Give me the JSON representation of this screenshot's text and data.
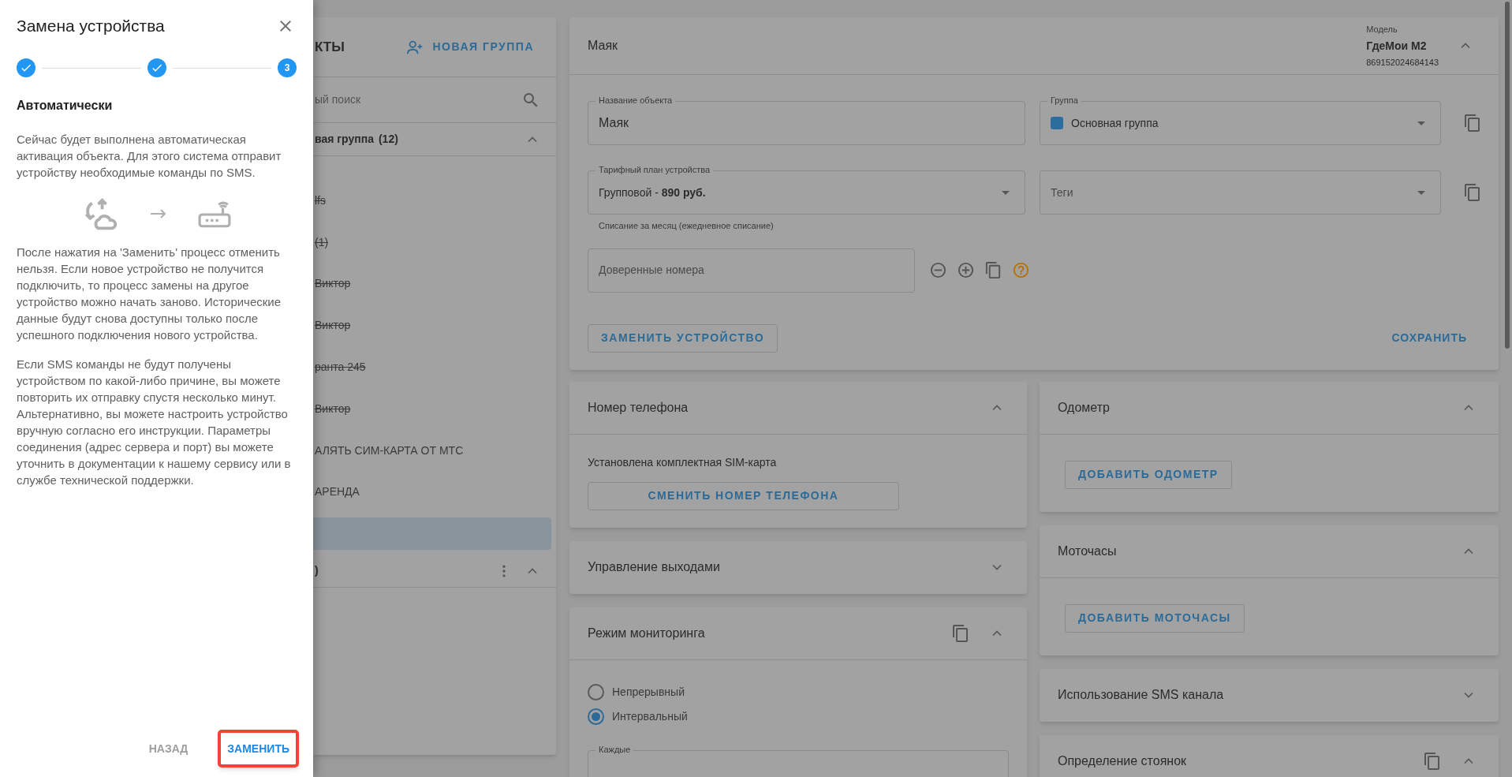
{
  "dialog": {
    "title": "Замена устройства",
    "steps": [
      {
        "completed": true
      },
      {
        "completed": true
      },
      {
        "completed": false,
        "label": "3"
      }
    ],
    "heading": "Автоматически",
    "intro": "Сейчас будет выполнена автоматическая активация объекта. Для этого система отправит устройству необходимые команды по SMS.",
    "notes": [
      "После нажатия на 'Заменить' процесс отменить нельзя. Если новое устройство не получится подключить, то процесс замены на другое устройство можно начать заново. Исторические данные будут снова доступны только после успешного подключения нового устройства.",
      "Если SMS команды не будут получены устройством по какой-либо причине, вы можете повторить их отправку спустя несколько минут. Альтернативно, вы можете настроить устройство вручную согласно его инструкции. Параметры соединения (адрес сервера и порт) вы можете уточнить в документации к нашему сервису или в службе технической поддержки."
    ],
    "buttons": [
      {
        "label": "НАЗАД",
        "kind": "secondary",
        "highlighted": false
      },
      {
        "label": "ЗАМЕНИТЬ",
        "kind": "primary",
        "highlighted": true
      }
    ]
  },
  "objects_panel": {
    "title": "КТЫ",
    "new_group_button": "НОВАЯ ГРУППА",
    "search_placeholder": "ый поиск",
    "groups": [
      {
        "name": "вая группа",
        "count": "(12)",
        "expanded": true,
        "items": [
          {
            "label": "lfs",
            "struck": true,
            "selected": false
          },
          {
            "label": "(1)",
            "struck": true,
            "selected": false
          },
          {
            "label": "Виктор",
            "struck": true,
            "selected": false
          },
          {
            "label": "Виктор",
            "struck": true,
            "selected": false
          },
          {
            "label": "ранта 245",
            "struck": true,
            "selected": false
          },
          {
            "label": "Виктор",
            "struck": true,
            "selected": false
          },
          {
            "label": "АЛЯТЬ СИМ-КАРТА ОТ МТС",
            "struck": false,
            "selected": false
          },
          {
            "label": "АРЕНДА",
            "struck": false,
            "selected": false
          },
          {
            "selected": true
          }
        ]
      },
      {
        "name": ")",
        "expanded": true,
        "has_menu": true
      }
    ]
  },
  "object_card": {
    "title": "Маяк",
    "model_label": "Модель",
    "model": "ГдеМои М2",
    "imei": "869152024684143",
    "expanded": true,
    "name_field": {
      "label": "Название объекта",
      "value": "Маяк"
    },
    "group_field": {
      "label": "Группа",
      "value": "Основная группа",
      "color": "#2b6e9e"
    },
    "tariff_field": {
      "label": "Тарифный план устройства",
      "value": "Групповой - **890 руб.**",
      "helper": "Списание за месяц (ежедневное списание)"
    },
    "tags_field": {
      "placeholder": "Теги"
    },
    "trusted_numbers_field": {
      "placeholder": "Доверенные номера"
    },
    "replace_button": "ЗАМЕНИТЬ УСТРОЙСТВО",
    "save_button": "СОХРАНИТЬ"
  },
  "left_sections": [
    {
      "kind": "phone",
      "title": "Номер телефона",
      "expanded": true,
      "text": "Установлена комплектная SIM-карта",
      "button": "СМЕНИТЬ НОМЕР ТЕЛЕФОНА"
    },
    {
      "title": "Управление выходами",
      "expanded": false
    },
    {
      "kind": "monitoring",
      "title": "Режим мониторинга",
      "expanded": true,
      "copyable": true,
      "options": [
        {
          "label": "Непрерывный",
          "selected": false
        },
        {
          "label": "Интервальный",
          "selected": true
        }
      ],
      "interval_label": "Каждые"
    }
  ],
  "right_sections": [
    {
      "kind": "button",
      "title": "Одометр",
      "expanded": true,
      "button": "ДОБАВИТЬ ОДОМЕТР"
    },
    {
      "kind": "button",
      "title": "Моточасы",
      "expanded": true,
      "button": "ДОБАВИТЬ МОТОЧАСЫ"
    },
    {
      "title": "Использование SMS канала",
      "expanded": false
    },
    {
      "title": "Определение стоянок",
      "expanded": true,
      "copyable": true
    }
  ]
}
